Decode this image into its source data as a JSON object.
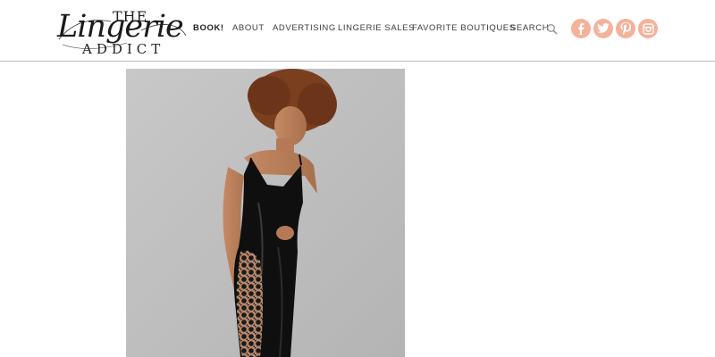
{
  "logo": {
    "the": "THE",
    "script": "Lingerie",
    "addict": "ADDICT"
  },
  "nav": {
    "book": "BOOK!",
    "about": "ABOUT",
    "advertising": "ADVERTISING",
    "lingerie_sales": "LINGERIE SALES",
    "favorite_boutiques": "FAVORITE BOUTIQUES",
    "search": "SEARCH"
  },
  "icons": {
    "search": "search-icon",
    "facebook": "facebook-icon",
    "twitter": "twitter-icon",
    "pinterest": "pinterest-icon",
    "instagram": "instagram-icon"
  },
  "colors": {
    "social_accent": "#f4b29a",
    "divider": "#b9b9b9"
  }
}
